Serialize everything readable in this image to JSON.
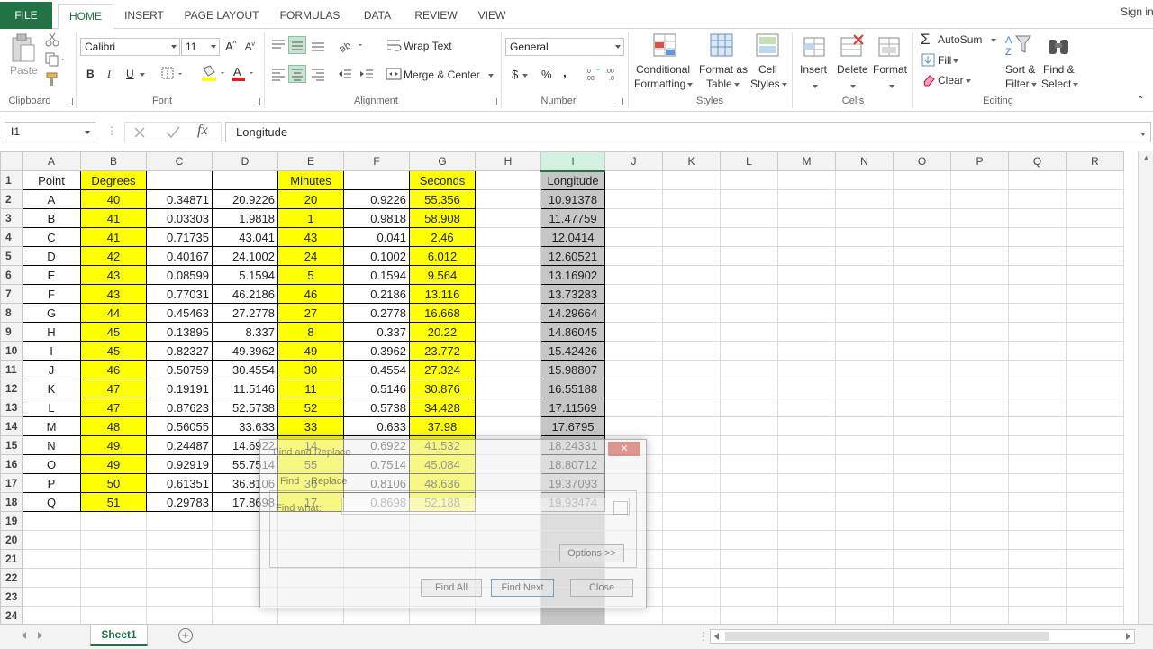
{
  "tabs": {
    "file": "FILE",
    "items": [
      "HOME",
      "INSERT",
      "PAGE LAYOUT",
      "FORMULAS",
      "DATA",
      "REVIEW",
      "VIEW"
    ],
    "active": "HOME",
    "signin": "Sign in"
  },
  "ribbon": {
    "clipboard": {
      "label": "Clipboard",
      "paste": "Paste"
    },
    "font": {
      "label": "Font",
      "name": "Calibri",
      "size": "11",
      "bold": "B",
      "italic": "I",
      "underline": "U"
    },
    "alignment": {
      "label": "Alignment",
      "wrap": "Wrap Text",
      "merge": "Merge & Center"
    },
    "number": {
      "label": "Number",
      "format": "General",
      "currency": "$",
      "percent": "%",
      "comma": ","
    },
    "styles": {
      "label": "Styles",
      "conditional_1": "Conditional",
      "conditional_2": "Formatting",
      "format_table_1": "Format as",
      "format_table_2": "Table",
      "cell_styles_1": "Cell",
      "cell_styles_2": "Styles"
    },
    "cells": {
      "label": "Cells",
      "insert": "Insert",
      "delete": "Delete",
      "format": "Format"
    },
    "editing": {
      "label": "Editing",
      "autosum": "AutoSum",
      "fill": "Fill",
      "clear": "Clear",
      "sort_1": "Sort &",
      "sort_2": "Filter",
      "find_1": "Find &",
      "find_2": "Select"
    }
  },
  "formula_bar": {
    "name_box": "I1",
    "content": "Longitude",
    "fx": "fx"
  },
  "columns": [
    "A",
    "B",
    "C",
    "D",
    "E",
    "F",
    "G",
    "H",
    "I",
    "J",
    "K",
    "L",
    "M",
    "N",
    "O",
    "P",
    "Q",
    "R"
  ],
  "selected_column": "I",
  "headers": [
    "Point",
    "Degrees",
    "",
    "",
    "Minutes",
    "",
    "Seconds",
    "",
    "Longitude"
  ],
  "rows": [
    [
      "A",
      "40",
      "0.34871",
      "20.9226",
      "20",
      "0.9226",
      "55.356",
      "",
      "10.91378"
    ],
    [
      "B",
      "41",
      "0.03303",
      "1.9818",
      "1",
      "0.9818",
      "58.908",
      "",
      "11.47759"
    ],
    [
      "C",
      "41",
      "0.71735",
      "43.041",
      "43",
      "0.041",
      "2.46",
      "",
      "12.0414"
    ],
    [
      "D",
      "42",
      "0.40167",
      "24.1002",
      "24",
      "0.1002",
      "6.012",
      "",
      "12.60521"
    ],
    [
      "E",
      "43",
      "0.08599",
      "5.1594",
      "5",
      "0.1594",
      "9.564",
      "",
      "13.16902"
    ],
    [
      "F",
      "43",
      "0.77031",
      "46.2186",
      "46",
      "0.2186",
      "13.116",
      "",
      "13.73283"
    ],
    [
      "G",
      "44",
      "0.45463",
      "27.2778",
      "27",
      "0.2778",
      "16.668",
      "",
      "14.29664"
    ],
    [
      "H",
      "45",
      "0.13895",
      "8.337",
      "8",
      "0.337",
      "20.22",
      "",
      "14.86045"
    ],
    [
      "I",
      "45",
      "0.82327",
      "49.3962",
      "49",
      "0.3962",
      "23.772",
      "",
      "15.42426"
    ],
    [
      "J",
      "46",
      "0.50759",
      "30.4554",
      "30",
      "0.4554",
      "27.324",
      "",
      "15.98807"
    ],
    [
      "K",
      "47",
      "0.19191",
      "11.5146",
      "11",
      "0.5146",
      "30.876",
      "",
      "16.55188"
    ],
    [
      "L",
      "47",
      "0.87623",
      "52.5738",
      "52",
      "0.5738",
      "34.428",
      "",
      "17.11569"
    ],
    [
      "M",
      "48",
      "0.56055",
      "33.633",
      "33",
      "0.633",
      "37.98",
      "",
      "17.6795"
    ],
    [
      "N",
      "49",
      "0.24487",
      "14.6922",
      "14",
      "0.6922",
      "41.532",
      "",
      "18.24331"
    ],
    [
      "O",
      "49",
      "0.92919",
      "55.7514",
      "55",
      "0.7514",
      "45.084",
      "",
      "18.80712"
    ],
    [
      "P",
      "50",
      "0.61351",
      "36.8106",
      "36",
      "0.8106",
      "48.636",
      "",
      "19.37093"
    ],
    [
      "Q",
      "51",
      "0.29783",
      "17.8698",
      "17",
      "0.8698",
      "52.188",
      "",
      "19.93474"
    ]
  ],
  "empty_rows": [
    "19",
    "20",
    "21",
    "22",
    "23",
    "24"
  ],
  "dialog": {
    "title": "Find and Replace",
    "close": "✕",
    "tab_find": "Find",
    "tab_replace": "Replace",
    "find_label": "Find what:",
    "options": "Options >>",
    "find_all": "Find All",
    "find_next": "Find Next",
    "close_btn": "Close"
  },
  "sheet": {
    "name": "Sheet1",
    "add": "+"
  },
  "colors": {
    "accent": "#217346",
    "highlight": "#ffff00",
    "selected": "#c6c6c6"
  }
}
